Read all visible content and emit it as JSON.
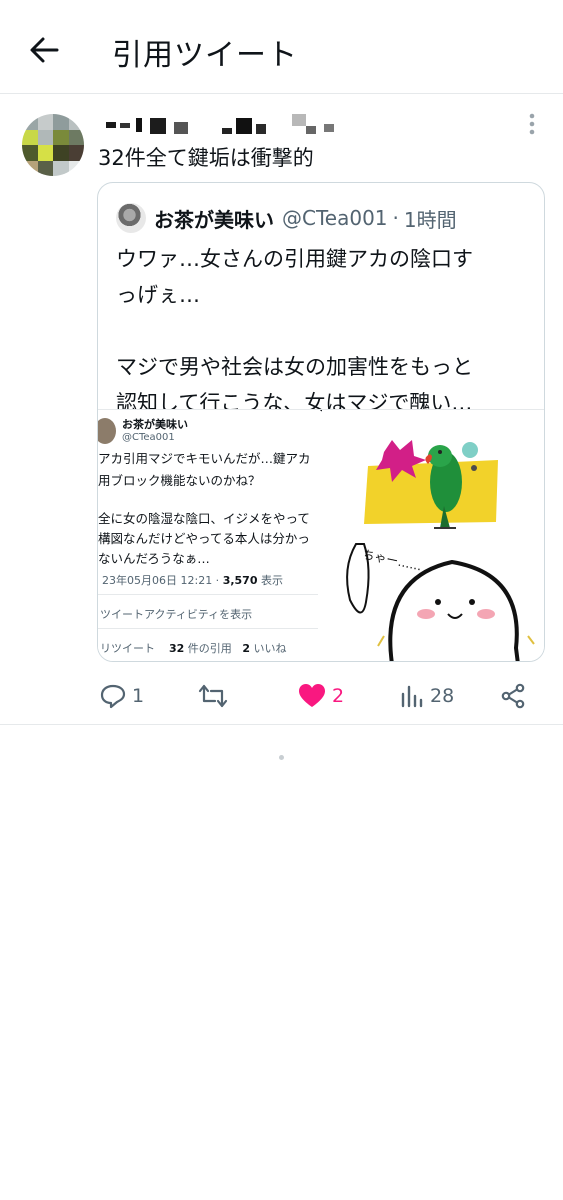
{
  "header": {
    "title": "引用ツイート",
    "back_icon": "arrow-left-icon"
  },
  "tweet": {
    "text": "32件全て鍵垢は衝撃的",
    "quoted": {
      "name": "お茶が美味い",
      "handle": "@CTea001",
      "separator": "·",
      "time": "1時間",
      "body_lines": [
        "ウワァ…女さんの引用鍵アカの陰口す",
        "っげぇ…",
        "",
        "マジで男や社会は女の加害性をもっと",
        "認知して行こうな、女はマジで醜い…"
      ],
      "media": {
        "screenshot": {
          "name": "お茶が美味い",
          "handle": "@CTea001",
          "lines": [
            "アカ引用マジでキモいんだが…鍵アカ",
            "用ブロック機能ないのかね？",
            "",
            "全に女の陰湿な陰口、イジメをやって",
            "構図なんだけどやってる本人は分かっ",
            "ないんだろうなぁ…"
          ],
          "meta_date": "23年05月06日 12:21 · ",
          "meta_views": "3,570",
          "meta_views_label": " 表示",
          "activity_link": "ツイートアクティビティを表示",
          "stat_retweets_label": "リツイート",
          "stat_quotes": "32",
          "stat_quotes_label": " 件の引用",
          "stat_likes": "2",
          "stat_likes_label": " いいね"
        },
        "cartoon_text": "ちゃー……"
      }
    },
    "actions": {
      "reply_count": "1",
      "retweet_count": "",
      "like_count": "2",
      "view_count": "28"
    }
  },
  "colors": {
    "text_primary": "#0f1419",
    "text_secondary": "#536471",
    "like_pink": "#f91880",
    "border": "#cfd9de"
  }
}
